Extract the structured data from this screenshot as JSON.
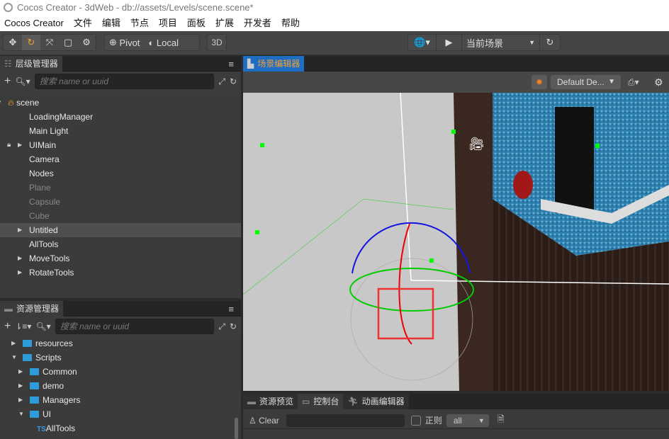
{
  "window": {
    "title": "Cocos Creator - 3dWeb - db://assets/Levels/scene.scene*"
  },
  "menu": [
    "Cocos Creator",
    "文件",
    "编辑",
    "节点",
    "项目",
    "面板",
    "扩展",
    "开发者",
    "帮助"
  ],
  "toolbar": {
    "pivot": "Pivot",
    "local": "Local",
    "mode3d": "3D",
    "scene_select": "当前场景"
  },
  "hierarchy": {
    "title": "层级管理器",
    "placeholder": "搜索 name or uuid",
    "items": [
      {
        "label": "scene",
        "indent": 0,
        "arrow": "down"
      },
      {
        "label": "LoadingManager",
        "indent": 1
      },
      {
        "label": "Main Light",
        "indent": 1
      },
      {
        "label": "UIMain",
        "indent": 1,
        "arrow": "right",
        "locked": true
      },
      {
        "label": "Camera",
        "indent": 1
      },
      {
        "label": "Nodes",
        "indent": 1
      },
      {
        "label": "Plane",
        "indent": 1,
        "dim": true
      },
      {
        "label": "Capsule",
        "indent": 1,
        "dim": true
      },
      {
        "label": "Cube",
        "indent": 1,
        "dim": true
      },
      {
        "label": "Untitled",
        "indent": 1,
        "arrow": "right",
        "selected": true
      },
      {
        "label": "AllTools",
        "indent": 1
      },
      {
        "label": "MoveTools",
        "indent": 1,
        "arrow": "right"
      },
      {
        "label": "RotateTools",
        "indent": 1,
        "arrow": "right"
      }
    ]
  },
  "assets": {
    "title": "资源管理器",
    "placeholder": "搜索 name or uuid",
    "items": [
      {
        "label": "resources",
        "indent": 1,
        "arrow": "right",
        "type": "folder"
      },
      {
        "label": "Scripts",
        "indent": 1,
        "arrow": "down",
        "type": "folder"
      },
      {
        "label": "Common",
        "indent": 2,
        "arrow": "right",
        "type": "folder"
      },
      {
        "label": "demo",
        "indent": 2,
        "arrow": "right",
        "type": "folder"
      },
      {
        "label": "Managers",
        "indent": 2,
        "arrow": "right",
        "type": "folder"
      },
      {
        "label": "UI",
        "indent": 2,
        "arrow": "down",
        "type": "folder"
      },
      {
        "label": "AllTools",
        "indent": 3,
        "type": "ts",
        "badge": "TS"
      }
    ]
  },
  "scene": {
    "title": "场景编辑器",
    "camera_select": "Default De..."
  },
  "bottom": {
    "tabs": [
      "资源预览",
      "控制台",
      "动画编辑器"
    ],
    "clear": "Clear",
    "regex": "正则",
    "filter": "all"
  }
}
